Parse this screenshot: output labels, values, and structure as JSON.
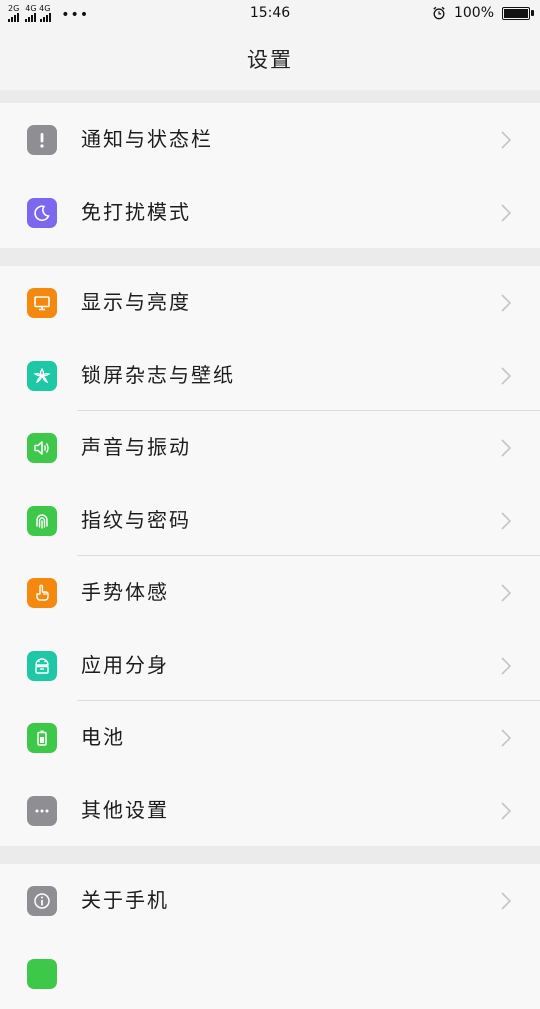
{
  "status_bar": {
    "net1_label": "2G",
    "net2_label": "4G 4G",
    "more": "•••",
    "time": "15:46",
    "battery_text": "100%",
    "battery_level": 1.0,
    "icons": [
      "signal-icon",
      "signal-icon",
      "alarm-clock-icon",
      "battery-icon"
    ]
  },
  "header": {
    "title": "设置"
  },
  "groups": [
    {
      "items": [
        {
          "label": "通知与状态栏",
          "icon": "exclamation-icon",
          "color": "#8e8e93"
        },
        {
          "label": "免打扰模式",
          "icon": "moon-icon",
          "color": "#7b68ee"
        }
      ]
    },
    {
      "items": [
        {
          "label": "显示与亮度",
          "icon": "monitor-icon",
          "color": "#f5890f"
        },
        {
          "label": "锁屏杂志与壁纸",
          "icon": "flower-icon",
          "color": "#1ec8a5"
        },
        {
          "label": "声音与振动",
          "icon": "speaker-icon",
          "color": "#3ec84a"
        },
        {
          "label": "指纹与密码",
          "icon": "fingerprint-icon",
          "color": "#3ec84a"
        },
        {
          "label": "手势体感",
          "icon": "hand-icon",
          "color": "#f5890f"
        },
        {
          "label": "应用分身",
          "icon": "android-icon",
          "color": "#1ec8a5"
        },
        {
          "label": "电池",
          "icon": "battery-icon",
          "color": "#3ec84a"
        },
        {
          "label": "其他设置",
          "icon": "more-icon",
          "color": "#8e8e93"
        }
      ]
    },
    {
      "items": [
        {
          "label": "关于手机",
          "icon": "info-icon",
          "color": "#8e8e93"
        },
        {
          "label": "",
          "icon": "partial-icon",
          "color": "#3ec84a"
        }
      ]
    }
  ]
}
